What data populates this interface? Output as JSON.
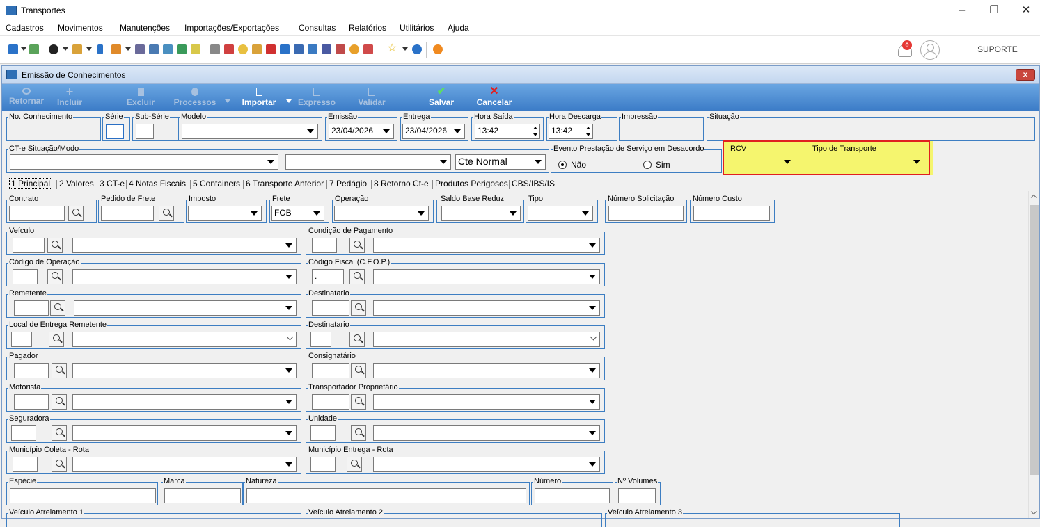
{
  "window": {
    "title": "Transportes"
  },
  "menu": [
    "Cadastros",
    "Movimentos",
    "Manutenções",
    "Importações/Exportações",
    "Consultas",
    "Relatórios",
    "Utilitários",
    "Ajuda"
  ],
  "toolbar": {
    "user": "SUPORTE",
    "notifications": "0"
  },
  "child": {
    "title": "Emissão de Conhecimentos",
    "close": "x"
  },
  "actions": {
    "retornar": "Retornar",
    "incluir": "Incluir",
    "excluir": "Excluir",
    "processos": "Processos",
    "importar": "Importar",
    "expresso": "Expresso",
    "validar": "Validar",
    "salvar": "Salvar",
    "cancelar": "Cancelar"
  },
  "header": {
    "no_conhecimento": "No. Conhecimento",
    "serie": "Série",
    "sub_serie": "Sub-Série",
    "modelo": "Modelo",
    "emissao": "Emissão",
    "emissao_val": "23/04/2026",
    "entrega": "Entrega",
    "entrega_val": "23/04/2026",
    "hora_saida": "Hora Saída",
    "hora_saida_val": "13:42",
    "hora_descarga": "Hora Descarga",
    "hora_descarga_val": "13:42",
    "impressao": "Impressão",
    "situacao": "Situação",
    "cte_situacao": "CT-e Situação/Modo",
    "cte_modo_val": "Cte Normal",
    "evento": "Evento Prestação de Serviço em Desacordo",
    "nao": "Não",
    "sim": "Sim",
    "rcv": "RCV",
    "tipo_transporte": "Tipo de Transporte"
  },
  "tabs": [
    "1 Principal",
    "2 Valores",
    "3 CT-e",
    "4 Notas Fiscais",
    "5 Containers",
    "6 Transporte Anterior",
    "7 Pedágio",
    "8 Retorno Ct-e",
    "Produtos Perigosos",
    "CBS/IBS/IS"
  ],
  "principal": {
    "contrato": "Contrato",
    "pedido_frete": "Pedido de Frete",
    "imposto": "Imposto",
    "frete": "Frete",
    "frete_val": "FOB",
    "operacao": "Operação",
    "saldo_base": "Saldo Base Reduz",
    "tipo": "Tipo",
    "numero_solicitacao": "Número Solicitação",
    "numero_custo": "Número Custo",
    "veiculo": "Veículo",
    "condicao_pagamento": "Condição de Pagamento",
    "codigo_operacao": "Código de Operação",
    "codigo_fiscal": "Código Fiscal (C.F.O.P.)",
    "codigo_fiscal_val": ".",
    "remetente": "Remetente",
    "destinatario": "Destinatario",
    "local_entrega": "Local de Entrega Remetente",
    "destinatario2": "Destinatario",
    "pagador": "Pagador",
    "consignatario": "Consignatário",
    "motorista": "Motorista",
    "transportador": "Transportador Proprietário",
    "seguradora": "Seguradora",
    "unidade": "Unidade",
    "municipio_coleta": "Município Coleta - Rota",
    "municipio_entrega": "Município Entrega - Rota",
    "especie": "Espécie",
    "marca": "Marca",
    "natureza": "Natureza",
    "numero": "Número",
    "volumes": "Nº Volumes",
    "atrelamento1": "Veículo Atrelamento 1",
    "atrelamento2": "Veículo Atrelamento 2",
    "atrelamento3": "Veículo Atrelamento 3"
  },
  "colors": {
    "accent": "#3d7ec2",
    "highlight": "#f5f56e",
    "annotation": "#e02020"
  }
}
